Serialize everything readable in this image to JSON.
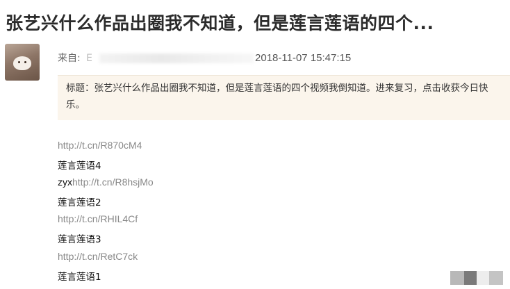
{
  "post": {
    "title": "张艺兴什么作品出圈我不知道，但是莲言莲语的四个...",
    "from_label": "来自:",
    "from_prefix": "E",
    "timestamp": "2018-11-07 15:47:15",
    "note": "标题：张艺兴什么作品出圈我不知道，但是莲言莲语的四个视频我倒知道。进来复习，点击收获今日快乐。"
  },
  "content": {
    "link1": "http://t.cn/R870cM4",
    "label4": "莲言莲语4",
    "prefix2": "zyx",
    "link2": "http://t.cn/R8hsjMo",
    "label2": "莲言莲语2",
    "link3": "http://t.cn/RHIL4Cf",
    "label3": "莲言莲语3",
    "link4": "http://t.cn/RetC7ck",
    "label1": "莲言莲语1"
  },
  "colors": {
    "title": "#2b2b2b",
    "link": "#888888",
    "note_background": "#fbf5ec"
  }
}
